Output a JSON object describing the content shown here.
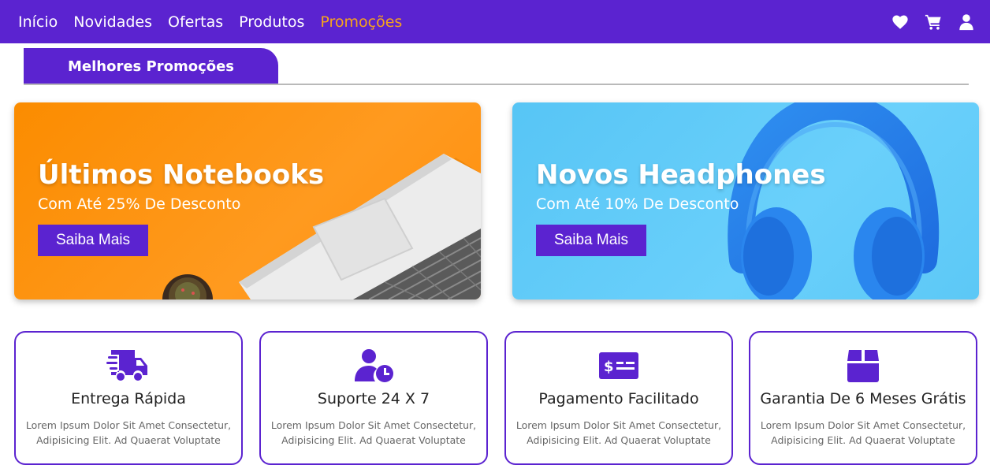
{
  "nav": {
    "links": [
      {
        "label": "Início"
      },
      {
        "label": "Novidades"
      },
      {
        "label": "Ofertas"
      },
      {
        "label": "Produtos"
      },
      {
        "label": "Promoções"
      }
    ],
    "active_color": "#f6a31d",
    "icons": [
      "heart-icon",
      "cart-icon",
      "user-icon"
    ]
  },
  "section": {
    "title": "Melhores Promoções"
  },
  "banners": [
    {
      "title": "Últimos Notebooks",
      "subtitle": "Com Até 25% De Desconto",
      "button": "Saiba Mais",
      "background": "#fb8c00"
    },
    {
      "title": "Novos Headphones",
      "subtitle": "Com Até 10% De Desconto",
      "button": "Saiba Mais",
      "background": "#5cc8f6"
    }
  ],
  "features": [
    {
      "icon": "delivery-truck-icon",
      "title": "Entrega Rápida",
      "text": "Lorem Ipsum Dolor Sit Amet Consectetur, Adipisicing Elit. Ad Quaerat Voluptate"
    },
    {
      "icon": "support-clock-icon",
      "title": "Suporte 24 X 7",
      "text": "Lorem Ipsum Dolor Sit Amet Consectetur, Adipisicing Elit. Ad Quaerat Voluptate"
    },
    {
      "icon": "payment-card-icon",
      "title": "Pagamento Facilitado",
      "text": "Lorem Ipsum Dolor Sit Amet Consectetur, Adipisicing Elit. Ad Quaerat Voluptate"
    },
    {
      "icon": "box-icon",
      "title": "Garantia De 6 Meses Grátis",
      "text": "Lorem Ipsum Dolor Sit Amet Consectetur, Adipisicing Elit. Ad Quaerat Voluptate"
    }
  ],
  "brand_color": "#5b23d0"
}
